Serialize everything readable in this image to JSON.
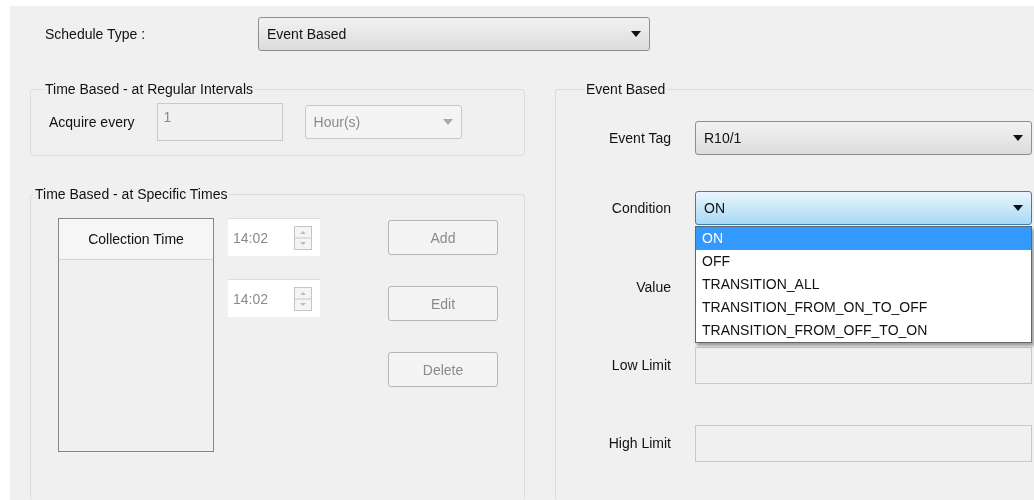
{
  "schedule_type": {
    "label": "Schedule Type :",
    "value": "Event Based"
  },
  "regular_intervals": {
    "title": "Time Based - at Regular Intervals",
    "label": "Acquire every",
    "value": "1",
    "unit": "Hour(s)",
    "disabled": true
  },
  "specific_times": {
    "title": "Time Based - at Specific Times",
    "list": {
      "columns": [
        "Collection Time"
      ]
    },
    "times": [
      {
        "value": "14:02",
        "disabled": true
      },
      {
        "value": "14:02",
        "disabled": true
      }
    ],
    "buttons": [
      {
        "label": "Add",
        "disabled": true
      },
      {
        "label": "Edit",
        "disabled": true
      },
      {
        "label": "Delete",
        "disabled": true
      }
    ]
  },
  "event_based": {
    "title": "Event Based",
    "fields": [
      {
        "kind": "combo",
        "label": "Event Tag",
        "value": "R10/1"
      },
      {
        "kind": "combo",
        "label": "Condition",
        "value": "ON",
        "focused": true,
        "expanded": true,
        "options": [
          {
            "label": "ON",
            "selected": true
          },
          {
            "label": "OFF",
            "selected": false
          },
          {
            "label": "TRANSITION_ALL",
            "selected": false
          },
          {
            "label": "TRANSITION_FROM_ON_TO_OFF",
            "selected": false
          },
          {
            "label": "TRANSITION_FROM_OFF_TO_ON",
            "selected": false
          }
        ]
      },
      {
        "kind": "covered",
        "label": "Value"
      },
      {
        "kind": "text",
        "label": "Low Limit",
        "disabled": true
      },
      {
        "kind": "text",
        "label": "High Limit",
        "disabled": true
      }
    ]
  }
}
